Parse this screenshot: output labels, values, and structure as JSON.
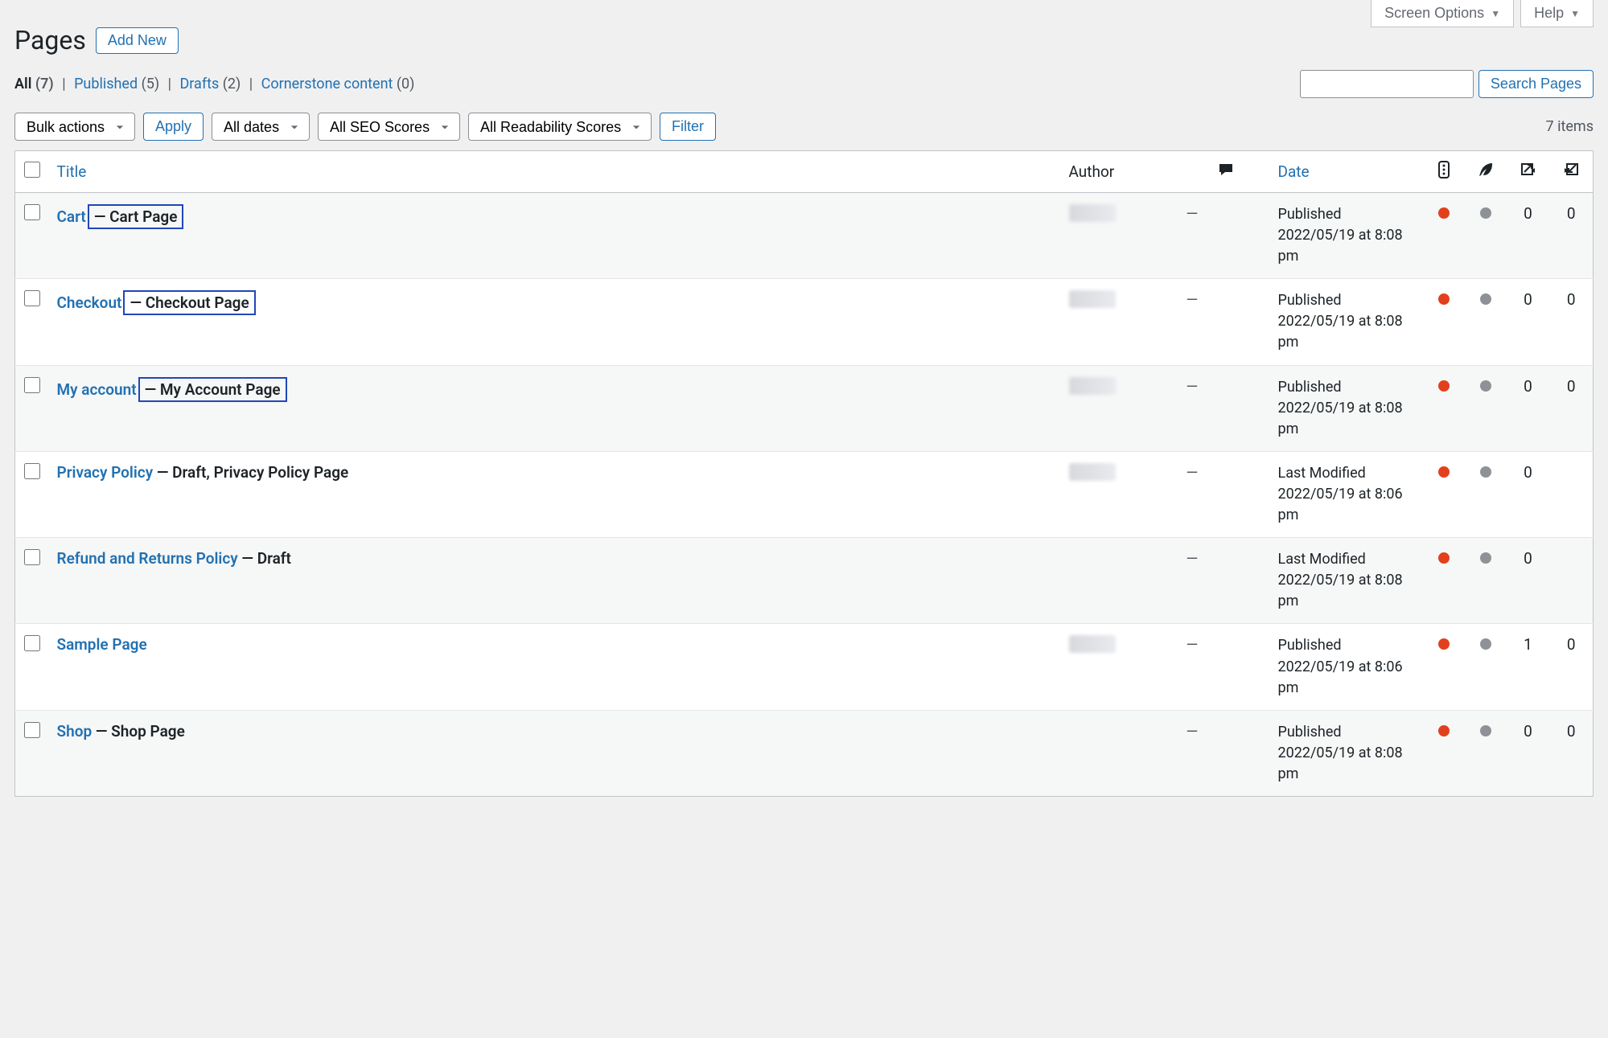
{
  "toolbar": {
    "screen_options": "Screen Options",
    "help": "Help"
  },
  "header": {
    "title": "Pages",
    "add_new": "Add New"
  },
  "filters_nav": {
    "all_label": "All",
    "all_count": "(7)",
    "published_label": "Published",
    "published_count": "(5)",
    "drafts_label": "Drafts",
    "drafts_count": "(2)",
    "cornerstone_label": "Cornerstone content",
    "cornerstone_count": "(0)"
  },
  "search": {
    "value": "",
    "button": "Search Pages"
  },
  "tablenav": {
    "bulk_actions": "Bulk actions",
    "apply": "Apply",
    "all_dates": "All dates",
    "all_seo": "All SEO Scores",
    "all_read": "All Readability Scores",
    "filter": "Filter",
    "item_count": "7 items"
  },
  "columns": {
    "title": "Title",
    "author": "Author",
    "date": "Date"
  },
  "rows": [
    {
      "title": "Cart",
      "state": " — Cart Page",
      "state_boxed": true,
      "author_blurred": true,
      "comments": "—",
      "date_status": "Published",
      "date_time": "2022/05/19 at 8:08 pm",
      "outgoing": "0",
      "incoming": "0",
      "show_incoming": true
    },
    {
      "title": "Checkout",
      "state": " — Checkout Page",
      "state_boxed": true,
      "author_blurred": true,
      "comments": "—",
      "date_status": "Published",
      "date_time": "2022/05/19 at 8:08 pm",
      "outgoing": "0",
      "incoming": "0",
      "show_incoming": true
    },
    {
      "title": "My account",
      "state": " — My Account Page",
      "state_boxed": true,
      "author_blurred": true,
      "comments": "—",
      "date_status": "Published",
      "date_time": "2022/05/19 at 8:08 pm",
      "outgoing": "0",
      "incoming": "0",
      "show_incoming": true
    },
    {
      "title": "Privacy Policy",
      "state": " — Draft, Privacy Policy Page",
      "state_boxed": false,
      "author_blurred": true,
      "comments": "—",
      "date_status": "Last Modified",
      "date_time": "2022/05/19 at 8:06 pm",
      "outgoing": "0",
      "incoming": "",
      "show_incoming": false
    },
    {
      "title": "Refund and Returns Policy",
      "state": " — Draft",
      "state_boxed": false,
      "author_blurred": false,
      "comments": "—",
      "date_status": "Last Modified",
      "date_time": "2022/05/19 at 8:08 pm",
      "outgoing": "0",
      "incoming": "",
      "show_incoming": false
    },
    {
      "title": "Sample Page",
      "state": "",
      "state_boxed": false,
      "author_blurred": true,
      "comments": "—",
      "date_status": "Published",
      "date_time": "2022/05/19 at 8:06 pm",
      "outgoing": "1",
      "incoming": "0",
      "show_incoming": true
    },
    {
      "title": "Shop",
      "state": " — Shop Page",
      "state_boxed": false,
      "author_blurred": false,
      "comments": "—",
      "date_status": "Published",
      "date_time": "2022/05/19 at 8:08 pm",
      "outgoing": "0",
      "incoming": "0",
      "show_incoming": true
    }
  ]
}
